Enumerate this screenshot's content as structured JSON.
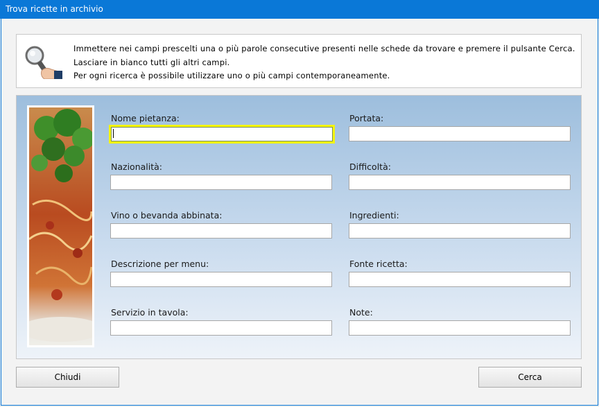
{
  "window": {
    "title": "Trova ricette in archivio"
  },
  "info": {
    "lines": [
      "Immettere nei campi prescelti una o più parole consecutive presenti nelle schede da trovare e premere il pulsante Cerca.",
      "Lasciare in bianco tutti gli altri campi.",
      "Per ogni ricerca è possibile utilizzare uno o più campi contemporaneamente."
    ]
  },
  "fields": [
    {
      "label": "Nome pietanza:",
      "value": "",
      "focused": true
    },
    {
      "label": "Portata:",
      "value": ""
    },
    {
      "label": "Nazionalità:",
      "value": ""
    },
    {
      "label": "Difficoltà:",
      "value": ""
    },
    {
      "label": "Vino o bevanda abbinata:",
      "value": ""
    },
    {
      "label": "Ingredienti:",
      "value": ""
    },
    {
      "label": "Descrizione per menu:",
      "value": ""
    },
    {
      "label": "Fonte ricetta:",
      "value": ""
    },
    {
      "label": "Servizio in tavola:",
      "value": ""
    },
    {
      "label": "Note:",
      "value": ""
    }
  ],
  "buttons": {
    "close": "Chiudi",
    "search": "Cerca"
  },
  "icons": {
    "info": "magnifier-hand-icon"
  },
  "colors": {
    "titlebar": "#0a78d7",
    "focus_highlight": "#f4f40a"
  }
}
